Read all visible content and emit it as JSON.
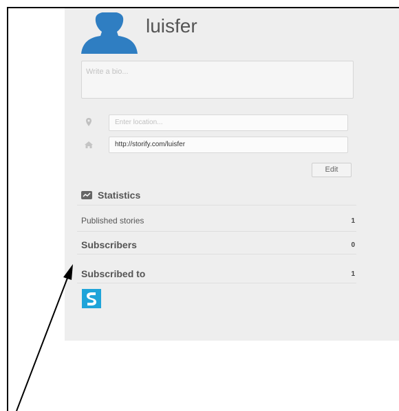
{
  "profile": {
    "username": "luisfer",
    "bio_placeholder": "Write a bio...",
    "location_placeholder": "Enter location...",
    "website_value": "http://storify.com/luisfer",
    "edit_label": "Edit"
  },
  "statistics": {
    "title": "Statistics",
    "rows": [
      {
        "label": "Published stories",
        "value": "1"
      },
      {
        "label": "Subscribers",
        "value": "0"
      },
      {
        "label": "Subscribed to",
        "value": "1"
      }
    ]
  },
  "icons": {
    "avatar": "user-silhouette-icon",
    "location": "map-pin-icon",
    "website": "home-icon",
    "statistics": "stats-icon",
    "subscription": "storify-logo-icon"
  },
  "colors": {
    "panel_background": "#eeeeee",
    "avatar_blue": "#2f7ec2",
    "storify_blue": "#1fa4d9",
    "annotation_arrow": "#000000"
  }
}
